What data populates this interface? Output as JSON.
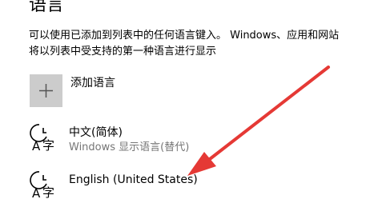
{
  "section": {
    "title": "语言",
    "description_line1": "可以使用已添加到列表中的任何语言键入。 Windows、应用和网站",
    "description_line2": "将以列表中受支持的第一种语言进行显示"
  },
  "add_language": {
    "icon": "plus-icon",
    "label": "添加语言"
  },
  "languages": [
    {
      "icon": "language-icon",
      "name": "中文(简体)",
      "detail": "Windows 显示语言(替代)"
    },
    {
      "icon": "language-icon",
      "name": "English (United States)"
    }
  ],
  "annotation": {
    "type": "arrow",
    "color": "#e53935"
  }
}
